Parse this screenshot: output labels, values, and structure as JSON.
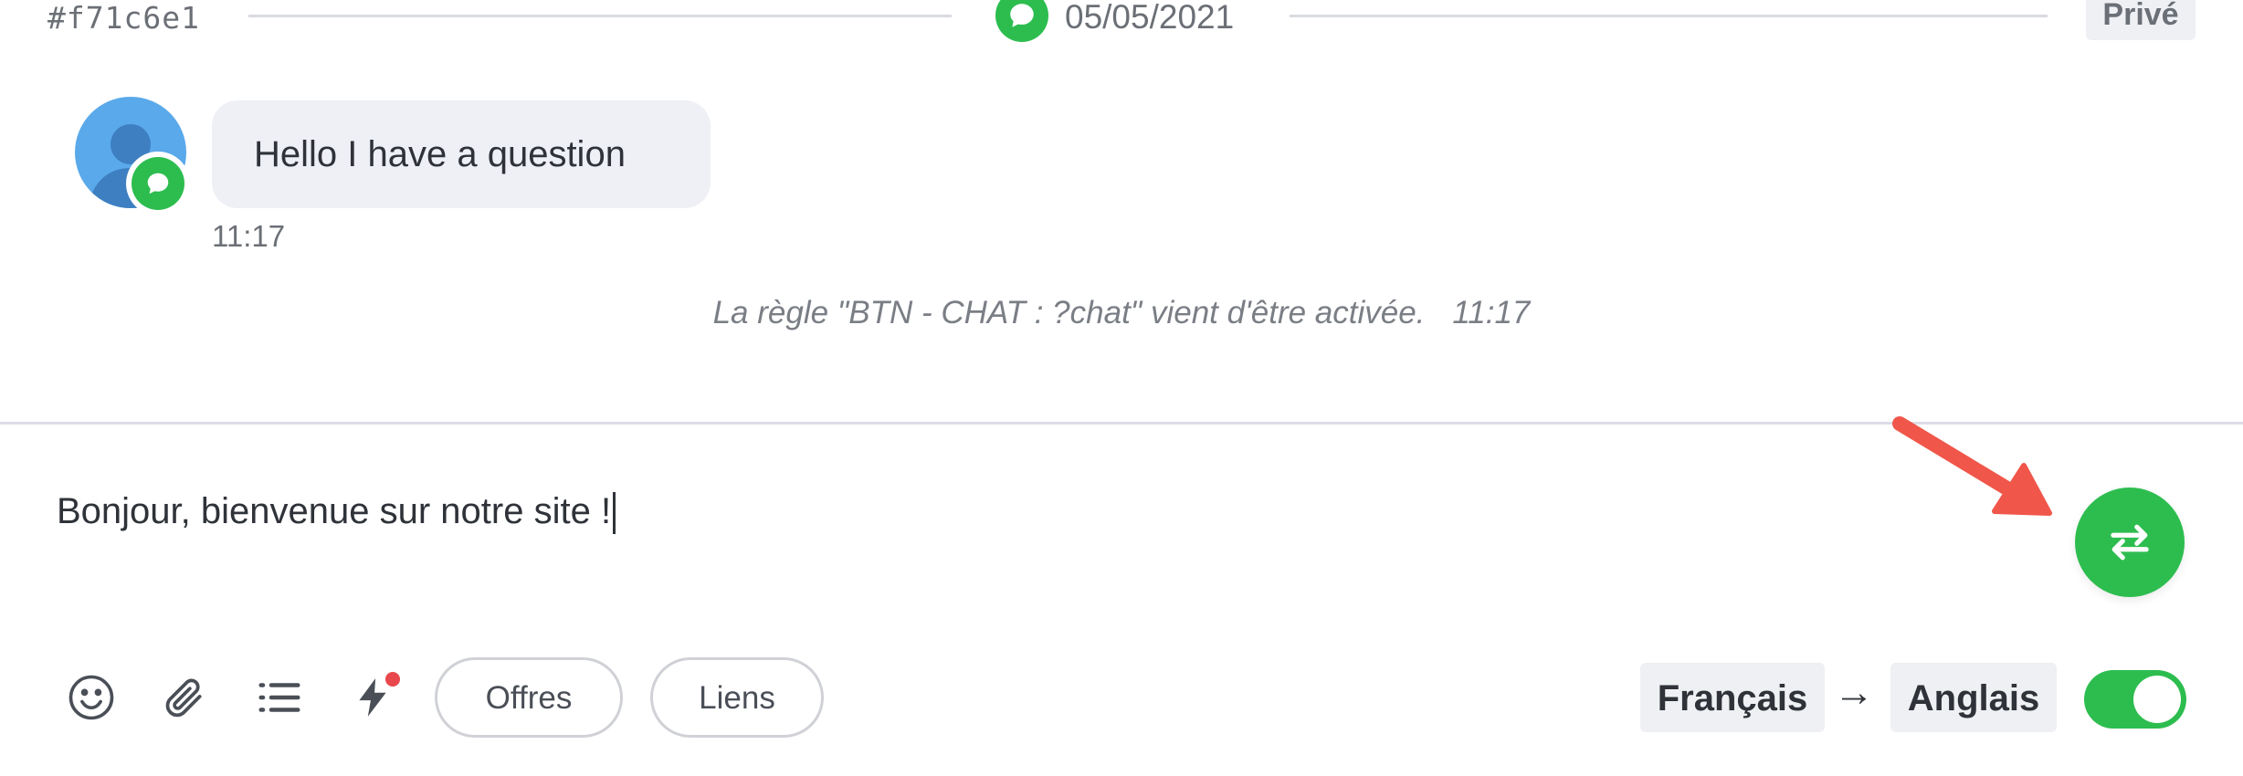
{
  "header": {
    "conversation_id": "#f71c6e1",
    "date": "05/05/2021",
    "privacy_label": "Privé"
  },
  "message": {
    "text": "Hello I have a question",
    "time": "11:17"
  },
  "system_note": {
    "text": "La règle \"BTN - CHAT : ?chat\" vient d'être activée.",
    "time": "11:17"
  },
  "composer": {
    "text": "Bonjour, bienvenue sur notre site !"
  },
  "toolbar": {
    "icons": [
      "emoji-icon",
      "paperclip-icon",
      "list-icon",
      "lightning-icon"
    ],
    "offers_label": "Offres",
    "links_label": "Liens"
  },
  "translation": {
    "source_language": "Français",
    "arrow": "→",
    "target_language": "Anglais",
    "enabled": true
  },
  "colors": {
    "accent_green": "#2dbd4f",
    "annotation_red": "#f0564a",
    "notification_red": "#e8474b"
  }
}
